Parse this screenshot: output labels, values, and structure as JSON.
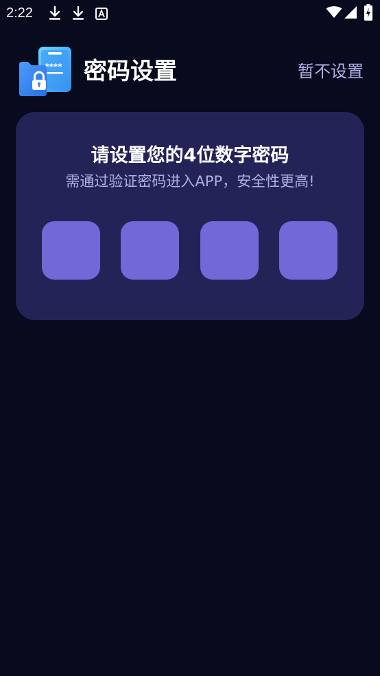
{
  "status_bar": {
    "time": "2:22",
    "left_icons": [
      "download-icon",
      "download-icon",
      "font-icon"
    ],
    "right_icons": [
      "wifi-icon",
      "signal-icon",
      "battery-charging-icon"
    ]
  },
  "header": {
    "title": "密码设置",
    "skip_label": "暂不设置",
    "logo_icon": "phone-lock-icon",
    "logo_text": "****"
  },
  "pin_card": {
    "heading": "请设置您的4位数字密码",
    "subtitle": "需通过验证密码进入APP，安全性更高!",
    "digit_count": 4,
    "digits": [
      "",
      "",
      "",
      ""
    ]
  },
  "colors": {
    "background": "#080a1d",
    "card": "#242358",
    "pin_box": "#7268d8",
    "accent_text": "#b1b0e6",
    "logo_blue": "#3f9bf5"
  }
}
